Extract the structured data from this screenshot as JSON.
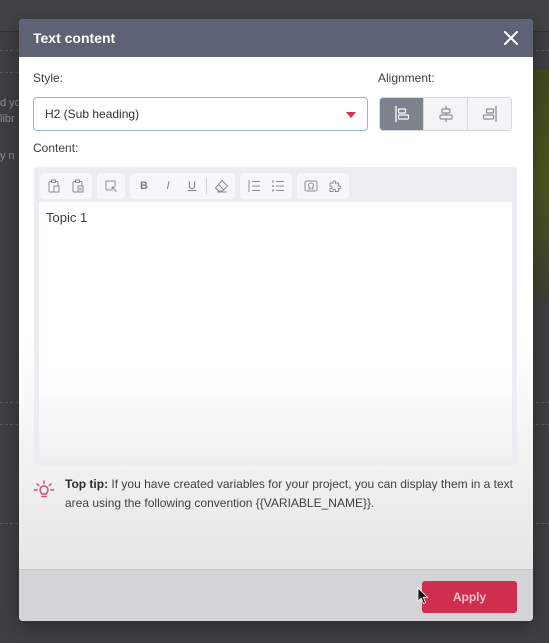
{
  "background": {
    "partial_texts": [
      "d yo",
      "libr",
      "y n"
    ]
  },
  "dialog": {
    "title": "Text content",
    "close_icon": "close-icon",
    "style_label": "Style:",
    "style_value": "H2 (Sub heading)",
    "alignment_label": "Alignment:",
    "alignment_options": [
      {
        "name": "align-left",
        "icon": "align-left-icon",
        "active": true
      },
      {
        "name": "align-center",
        "icon": "align-center-icon",
        "active": false
      },
      {
        "name": "align-right",
        "icon": "align-right-icon",
        "active": false
      }
    ],
    "content_label": "Content:",
    "toolbar": {
      "paste": "paste-icon",
      "paste_text": "paste-text-icon",
      "select": "select-area-icon",
      "bold": "B",
      "italic": "I",
      "underline": "U",
      "eraser": "eraser-icon",
      "ordered_list": "ordered-list-icon",
      "bullet_list": "bullet-list-icon",
      "special_char": "omega-icon",
      "plugin": "puzzle-icon"
    },
    "content_text": "Topic 1",
    "tip": {
      "bold": "Top tip:",
      "text": " If you have created variables for your project, you can display them in a text area using the following convention {{VARIABLE_NAME}}."
    },
    "apply_label": "Apply",
    "accent_color": "#cf2e4f",
    "header_color": "#5d6274"
  }
}
